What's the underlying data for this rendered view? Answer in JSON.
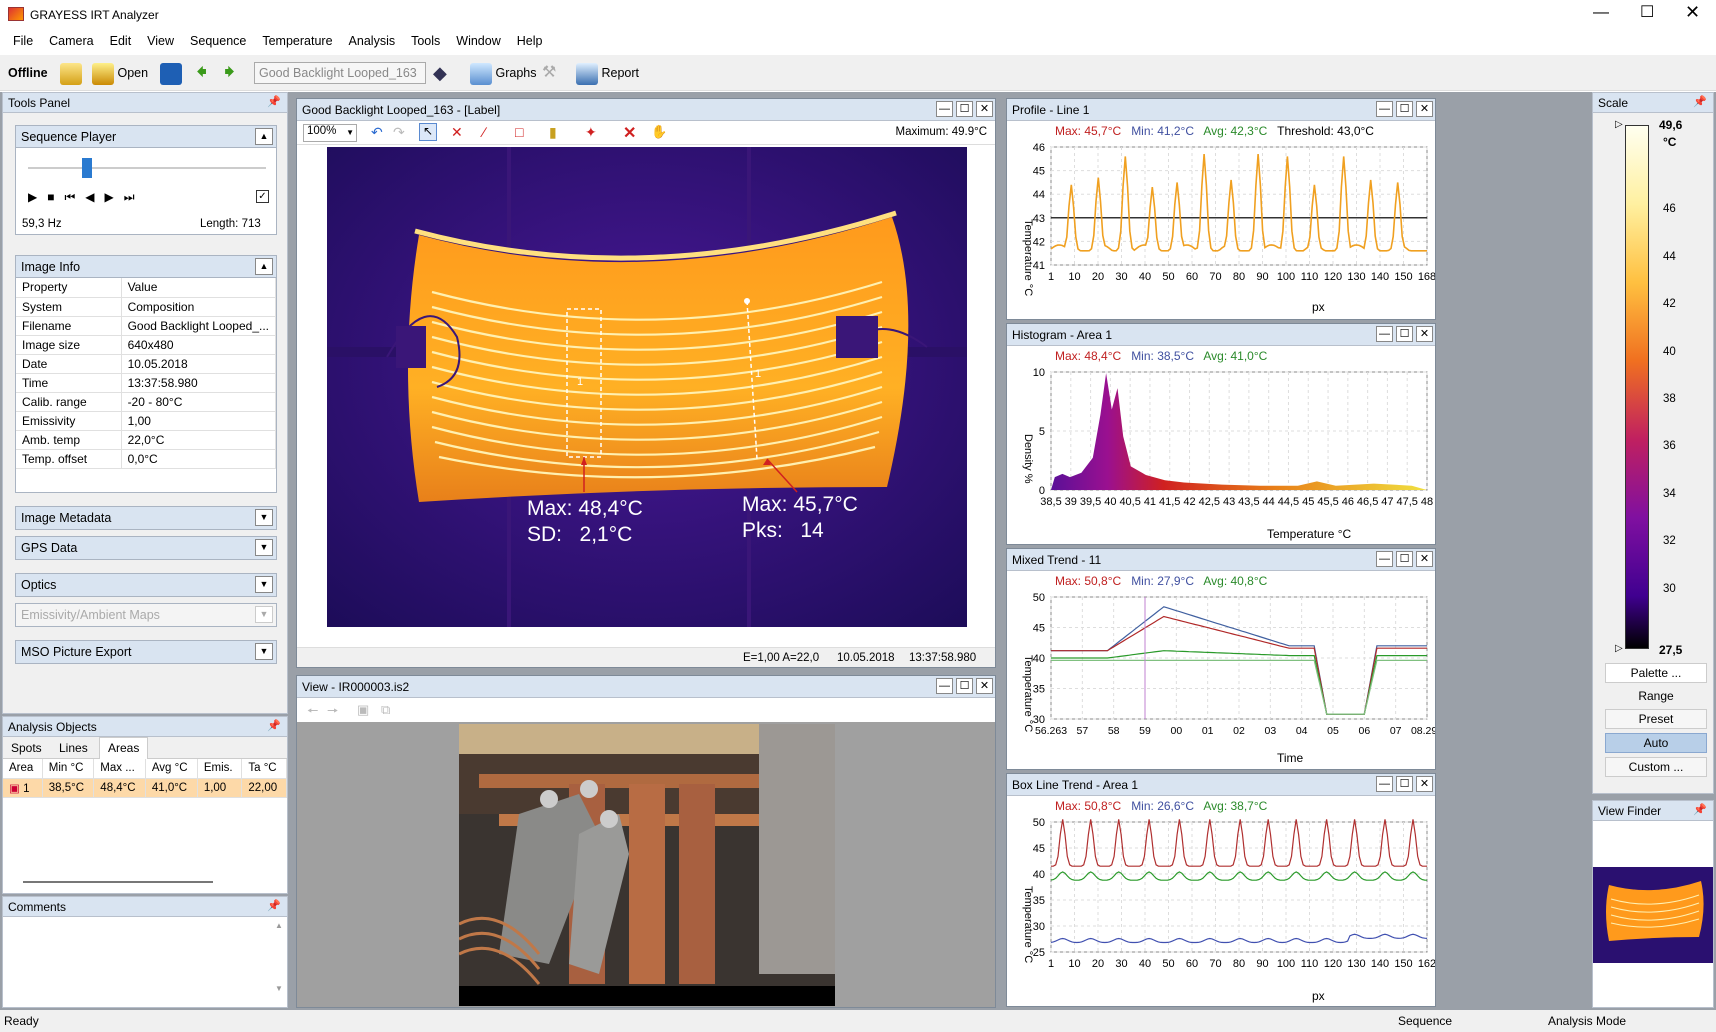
{
  "app": {
    "title": "GRAYESS IRT Analyzer"
  },
  "menu": [
    "File",
    "Camera",
    "Edit",
    "View",
    "Sequence",
    "Temperature",
    "Analysis",
    "Tools",
    "Window",
    "Help"
  ],
  "toolbar": {
    "status": "Offline",
    "open": "Open",
    "sequence_field": "Good Backlight Looped_163",
    "graphs": "Graphs",
    "report": "Report"
  },
  "tools_panel": {
    "title": "Tools Panel"
  },
  "sequence_player": {
    "title": "Sequence Player",
    "rate": "59,3 Hz",
    "length": "Length: 713",
    "position": 0.12
  },
  "image_info": {
    "title": "Image Info",
    "col_property": "Property",
    "col_value": "Value",
    "rows": [
      [
        "System",
        "Composition"
      ],
      [
        "Filename",
        "Good Backlight Looped_..."
      ],
      [
        "Image size",
        "640x480"
      ],
      [
        "Date",
        "10.05.2018"
      ],
      [
        "Time",
        "13:37:58.980"
      ],
      [
        "Calib. range",
        "-20 - 80°C"
      ],
      [
        "Emissivity",
        "1,00"
      ],
      [
        "Amb. temp",
        "22,0°C"
      ],
      [
        "Temp. offset",
        "0,0°C"
      ]
    ]
  },
  "collapsed_sections": [
    "Image Metadata",
    "GPS Data",
    "Optics",
    "Emissivity/Ambient Maps",
    "MSO Picture Export"
  ],
  "analysis_objects": {
    "title": "Analysis Objects",
    "tabs": [
      "Spots",
      "Lines",
      "Areas"
    ],
    "active_tab": "Areas",
    "headers": [
      "Area",
      "Min °C",
      "Max ...",
      "Avg °C",
      "Emis.",
      "Ta °C"
    ],
    "rows": [
      [
        "1",
        "38,5°C",
        "48,4°C",
        "41,0°C",
        "1,00",
        "22,00"
      ]
    ]
  },
  "comments": {
    "title": "Comments"
  },
  "ir_window": {
    "title": "Good Backlight Looped_163 - [Label]",
    "zoom": "100%",
    "maximum": "Maximum: 49.9°C",
    "label1_line1": "Max: 48,4°C",
    "label1_line2": "SD:   2,1°C",
    "label2_line1": "Max: 45,7°C",
    "label2_line2": "Pks:   14",
    "marker1": "1",
    "marker2": "1",
    "status_emis": "E=1,00 A=22,0",
    "status_date": "10.05.2018",
    "status_time": "13:37:58.980"
  },
  "view_window": {
    "title": "View - IR000003.is2"
  },
  "profile": {
    "title": "Profile - Line 1",
    "max": "Max: 45,7°C",
    "min": "Min: 41,2°C",
    "avg": "Avg: 42,3°C",
    "threshold": "Threshold: 43,0°C",
    "ylabel": "Temperature °C",
    "xlabel": "px",
    "yticks": [
      "46",
      "45",
      "44",
      "43",
      "42",
      "41"
    ],
    "xticks": [
      "1",
      "10",
      "20",
      "30",
      "40",
      "50",
      "60",
      "70",
      "80",
      "90",
      "100",
      "110",
      "120",
      "130",
      "140",
      "150",
      "168"
    ]
  },
  "histogram": {
    "title": "Histogram - Area 1",
    "max": "Max: 48,4°C",
    "min": "Min: 38,5°C",
    "avg": "Avg: 41,0°C",
    "ylabel": "Density %",
    "xlabel": "Temperature °C",
    "yticks": [
      "10",
      "5",
      "0"
    ],
    "xticks": [
      "38,5",
      "39",
      "39,5",
      "40",
      "40,5",
      "41",
      "41,5",
      "42",
      "42,5",
      "43",
      "43,5",
      "44",
      "44,5",
      "45",
      "45,5",
      "46",
      "46,5",
      "47",
      "47,5",
      "48"
    ]
  },
  "mixed_trend": {
    "title": "Mixed Trend - 11",
    "max": "Max: 50,8°C",
    "min": "Min: 27,9°C",
    "avg": "Avg: 40,8°C",
    "ylabel": "Temperature °C",
    "xlabel": "Time",
    "yticks": [
      "50",
      "45",
      "40",
      "35",
      "30"
    ],
    "xticks": [
      "56.263",
      "57",
      "58",
      "59",
      "00",
      "01",
      "02",
      "03",
      "04",
      "05",
      "06",
      "07",
      "08.294"
    ]
  },
  "box_trend": {
    "title": "Box Line Trend - Area 1",
    "max": "Max: 50,8°C",
    "min": "Min: 26,6°C",
    "avg": "Avg: 38,7°C",
    "ylabel": "Temperature °C",
    "xlabel": "px",
    "yticks": [
      "50",
      "45",
      "40",
      "35",
      "30",
      "25"
    ],
    "xticks": [
      "1",
      "10",
      "20",
      "30",
      "40",
      "50",
      "60",
      "70",
      "80",
      "90",
      "100",
      "110",
      "120",
      "130",
      "140",
      "150",
      "162"
    ]
  },
  "scale": {
    "title": "Scale",
    "max": "49,6",
    "unit": "°C",
    "min": "27,5",
    "ticks": [
      "46",
      "44",
      "42",
      "40",
      "38",
      "36",
      "34",
      "32",
      "30"
    ],
    "palette": "Palette ...",
    "range": "Range",
    "preset": "Preset",
    "auto": "Auto",
    "custom": "Custom ..."
  },
  "view_finder": {
    "title": "View Finder"
  },
  "status": {
    "left": "Ready",
    "mid": "Sequence",
    "right": "Analysis Mode"
  },
  "colors": {
    "accent": "#d9e4f1",
    "max": "#c02020",
    "min": "#4050a0",
    "avg": "#2a8a2a"
  }
}
